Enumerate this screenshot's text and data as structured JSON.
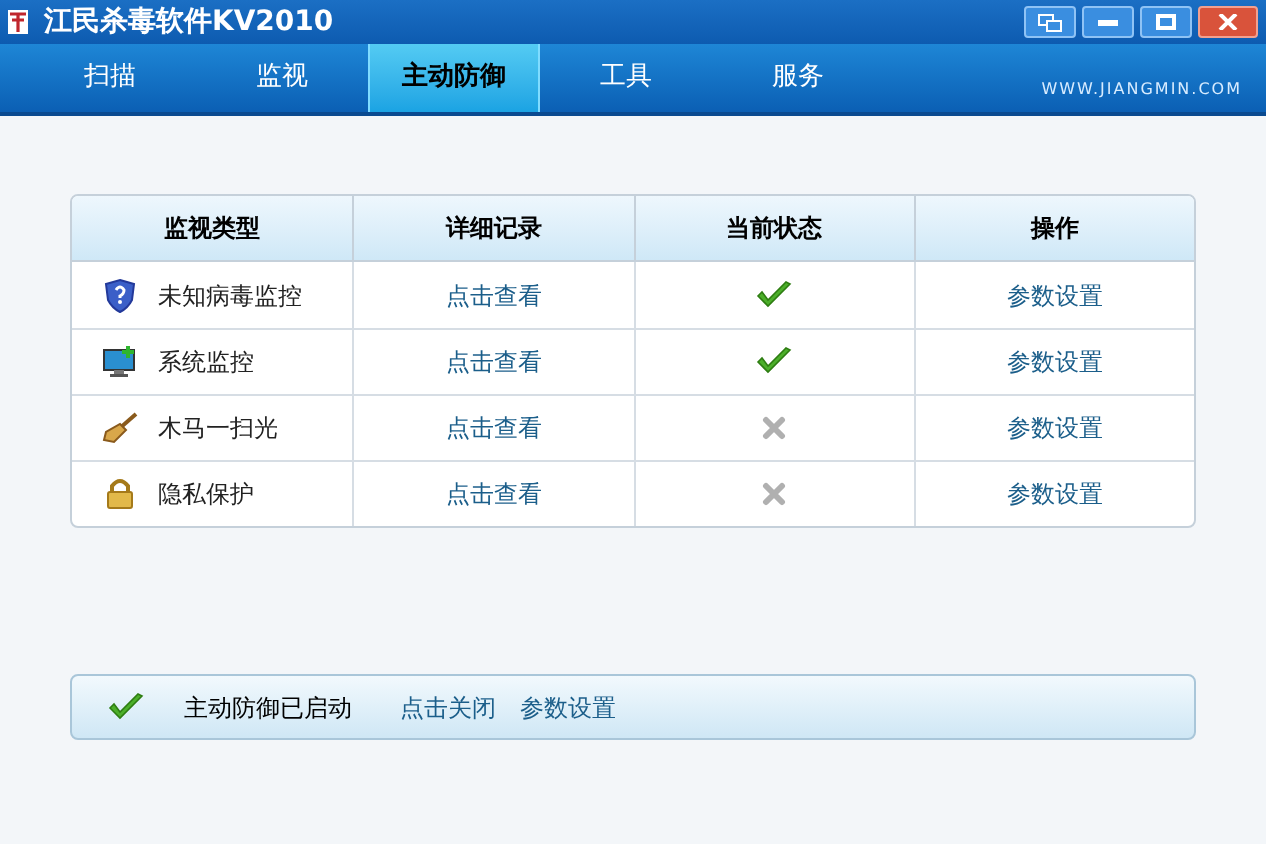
{
  "window": {
    "title": "江民杀毒软件KV2010"
  },
  "tabs": [
    {
      "label": "扫描",
      "selected": false
    },
    {
      "label": "监视",
      "selected": false
    },
    {
      "label": "主动防御",
      "selected": true
    },
    {
      "label": "工具",
      "selected": false
    },
    {
      "label": "服务",
      "selected": false
    }
  ],
  "site": "WWW.JIANGMIN.COM",
  "table": {
    "columns": [
      "监视类型",
      "详细记录",
      "当前状态",
      "操作"
    ],
    "rows": [
      {
        "kind": "virus",
        "name": "未知病毒监控",
        "record": "点击查看",
        "enabled": true,
        "action": "参数设置"
      },
      {
        "kind": "system",
        "name": "系统监控",
        "record": "点击查看",
        "enabled": true,
        "action": "参数设置"
      },
      {
        "kind": "trojan",
        "name": "木马一扫光",
        "record": "点击查看",
        "enabled": false,
        "action": "参数设置"
      },
      {
        "kind": "privacy",
        "name": "隐私保护",
        "record": "点击查看",
        "enabled": false,
        "action": "参数设置"
      }
    ]
  },
  "status_bar": {
    "enabled": true,
    "text": "主动防御已启动",
    "links": [
      "点击关闭",
      "参数设置"
    ]
  }
}
